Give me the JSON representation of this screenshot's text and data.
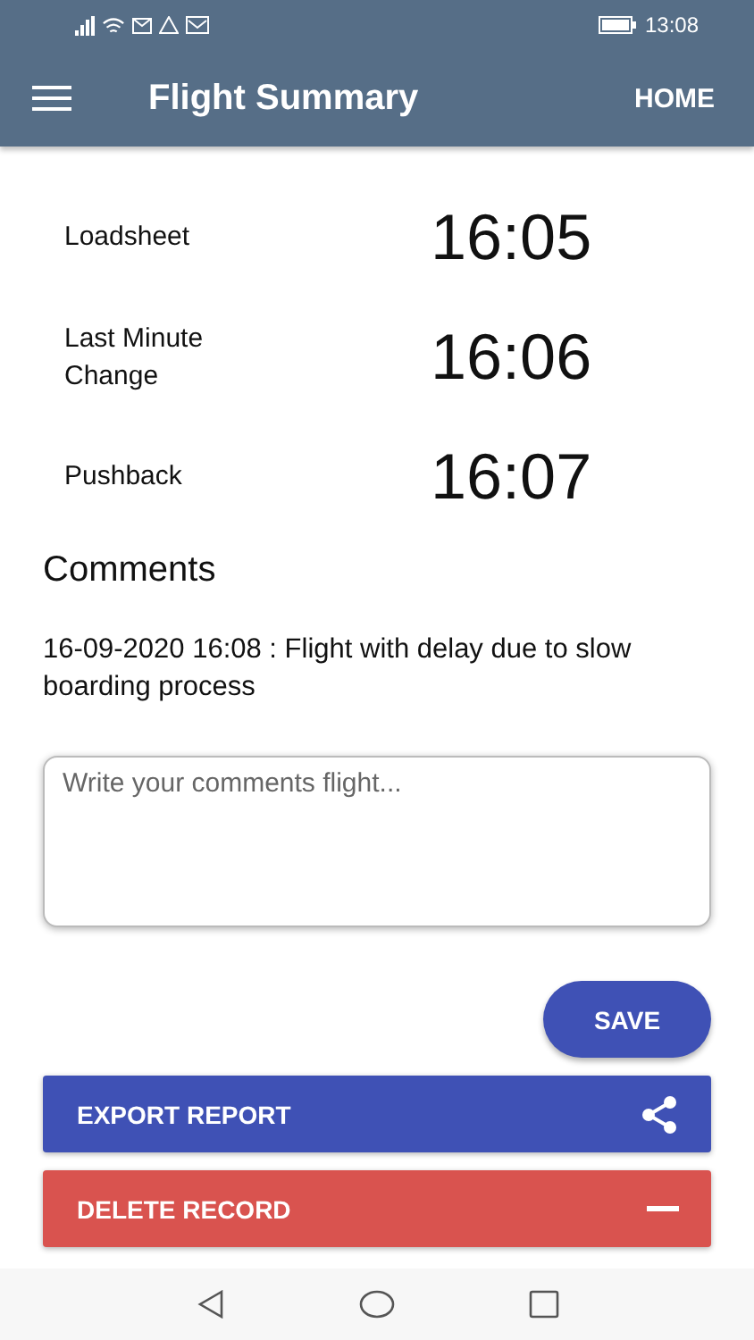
{
  "status_bar": {
    "time": "13:08"
  },
  "app_bar": {
    "title": "Flight Summary",
    "action": "HOME"
  },
  "times": [
    {
      "label": "Loadsheet",
      "time": "16:05"
    },
    {
      "label": "Last Minute Change",
      "time": "16:06"
    },
    {
      "label": "Pushback",
      "time": "16:07"
    }
  ],
  "comments": {
    "heading": "Comments",
    "entries": [
      "16-09-2020 16:08 : Flight with delay due to slow boarding process"
    ],
    "placeholder": "Write your comments flight..."
  },
  "save_button": "SAVE",
  "actions": [
    {
      "label": "EXPORT REPORT",
      "kind": "export"
    },
    {
      "label": "DELETE RECORD",
      "kind": "delete"
    }
  ]
}
